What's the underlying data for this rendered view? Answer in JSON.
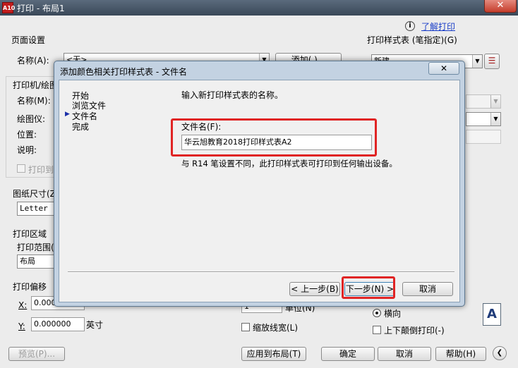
{
  "window": {
    "title": "打印 - 布局1",
    "icon_text": "A10",
    "close": "✕"
  },
  "help": {
    "icon": "ⓘ",
    "link": "了解打印"
  },
  "page_setup": {
    "title": "页面设置",
    "name_label": "名称(A):",
    "name_value": "<无>",
    "add_label": "添加(.)..."
  },
  "printer": {
    "title": "打印机/绘图仪",
    "name_label": "名称(M):",
    "plotter_label": "绘图仪:",
    "location_label": "位置:",
    "description_label": "说明:",
    "print_to_file": "打印到文件(F)"
  },
  "paper": {
    "title": "图纸尺寸(Z)",
    "value": "Letter"
  },
  "print_area": {
    "title": "打印区域",
    "range_label": "打印范围(W):",
    "range_value": "布局"
  },
  "offset": {
    "title": "打印偏移",
    "x_label": "X:",
    "x_value": "0.000000",
    "y_label": "Y:",
    "y_value": "0.000000",
    "unit": "英寸"
  },
  "scale": {
    "units_label": "单位(N)",
    "units_value": "1",
    "lineweights": "缩放线宽(L)"
  },
  "style_table": {
    "title": "打印样式表 (笔指定)(G)",
    "value": "新建",
    "edit_icon": "edit-icon"
  },
  "orientation": {
    "landscape": "横向",
    "upside_down": "上下颠倒打印(-)",
    "icon_text": "A"
  },
  "bottom": {
    "preview": "预览(P)...",
    "apply": "应用到布局(T)",
    "ok": "确定",
    "cancel": "取消",
    "help": "帮助(H)",
    "expand": "❮"
  },
  "dialog": {
    "title": "添加颜色相关打印样式表 - 文件名",
    "close": "✕",
    "steps": [
      "开始",
      "浏览文件",
      "文件名",
      "完成"
    ],
    "current_step": 2,
    "instruction": "输入新打印样式表的名称。",
    "filename_label": "文件名(F):",
    "filename_value": "华云旭教育2018打印样式表A2",
    "note": "与 R14 笔设置不同，此打印样式表可打印到任何输出设备。",
    "back": "< 上一步(B)",
    "next": "下一步(N) >",
    "cancel": "取消"
  }
}
